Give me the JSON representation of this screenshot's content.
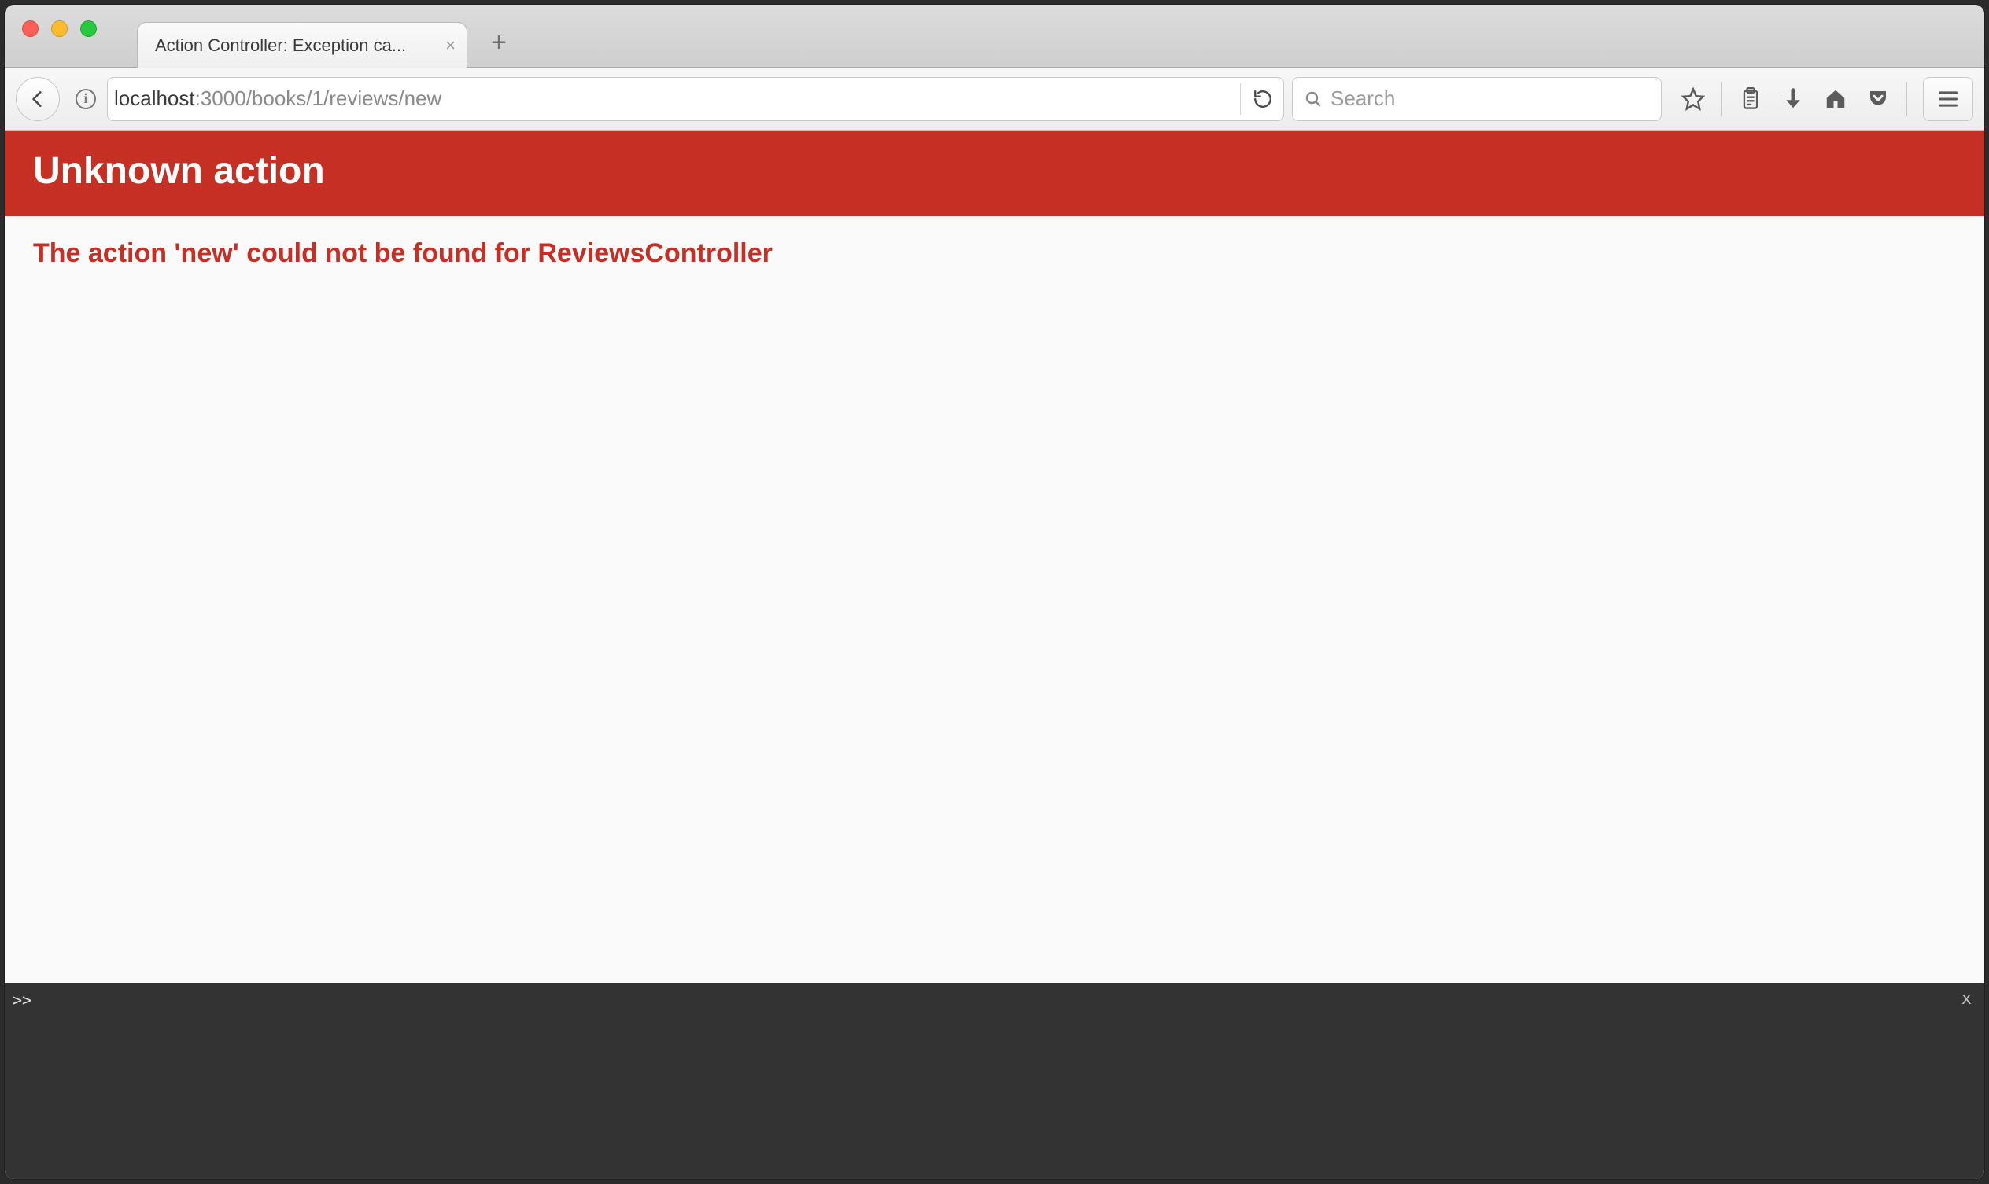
{
  "window": {
    "tab_title": "Action Controller: Exception ca...",
    "new_tab_label": "+"
  },
  "toolbar": {
    "address": {
      "host": "localhost",
      "port": ":3000",
      "path": "/books/1/reviews/new"
    },
    "search_placeholder": "Search"
  },
  "page": {
    "error_title": "Unknown action",
    "error_message": "The action 'new' could not be found for ReviewsController"
  },
  "console": {
    "prompt": ">>",
    "close_glyph": "x"
  },
  "colors": {
    "rails_red": "#c52f24",
    "console_bg": "#333333"
  }
}
